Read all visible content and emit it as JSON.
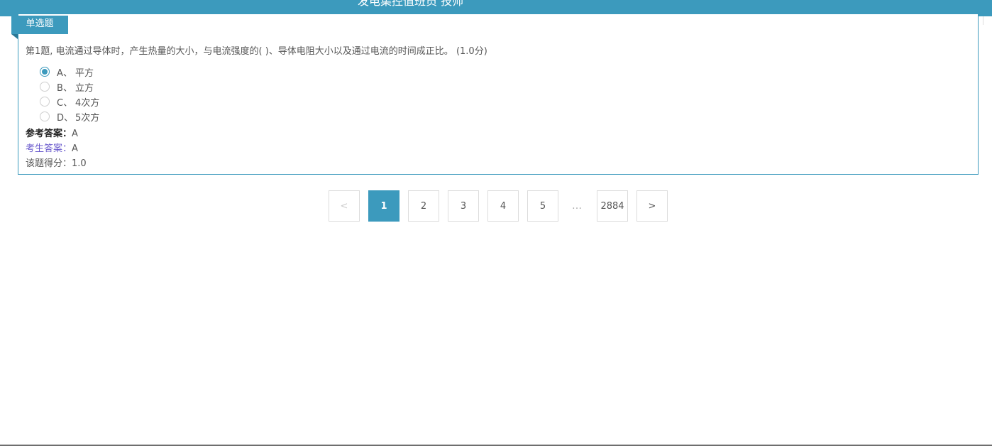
{
  "header": {
    "title": "发电集控值班员 技师"
  },
  "question": {
    "type_label": "单选题",
    "stem": "第1题, 电流通过导体时，产生热量的大小，与电流强度的( )、导体电阻大小以及通过电流的时间成正比。 (1.0分)",
    "options": [
      {
        "letter": "A、",
        "text": "平方",
        "selected": true
      },
      {
        "letter": "B、",
        "text": "立方",
        "selected": false
      },
      {
        "letter": "C、",
        "text": "4次方",
        "selected": false
      },
      {
        "letter": "D、",
        "text": "5次方",
        "selected": false
      }
    ],
    "reference_answer_label": "参考答案：",
    "reference_answer": "A",
    "student_answer_label": "考生答案：",
    "student_answer": "A",
    "score_label": "该题得分：",
    "score": "1.0"
  },
  "pagination": {
    "prev": "<",
    "pages": [
      "1",
      "2",
      "3",
      "4",
      "5"
    ],
    "current": "1",
    "ellipsis": "…",
    "last": "2884",
    "next": ">"
  },
  "colors": {
    "accent": "#3c9abd",
    "student_label": "#6a5acd"
  }
}
